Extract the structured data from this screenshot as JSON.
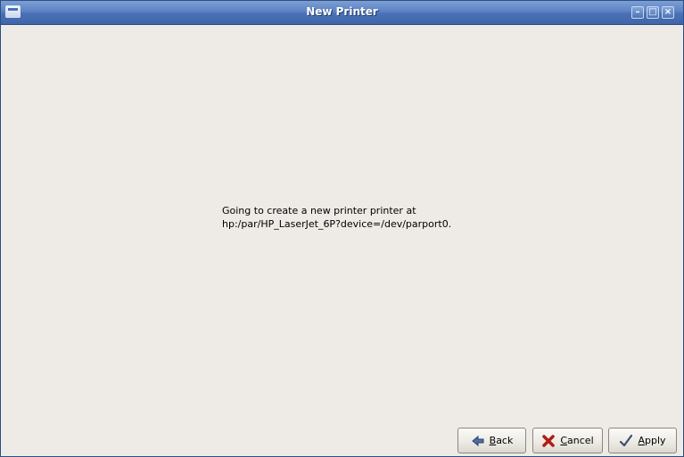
{
  "window": {
    "title": "New Printer"
  },
  "message": {
    "line1": "Going to create a new printer printer at",
    "line2": "hp:/par/HP_LaserJet_6P?device=/dev/parport0."
  },
  "buttons": {
    "back": {
      "mnemonic": "B",
      "rest": "ack",
      "icon": "back-arrow-icon"
    },
    "cancel": {
      "mnemonic": "C",
      "rest": "ancel",
      "icon": "cancel-x-icon"
    },
    "apply": {
      "mnemonic": "A",
      "rest": "pply",
      "icon": "checkmark-icon"
    }
  },
  "colors": {
    "titlebar": "#4a71b5",
    "background": "#eeebe6"
  }
}
